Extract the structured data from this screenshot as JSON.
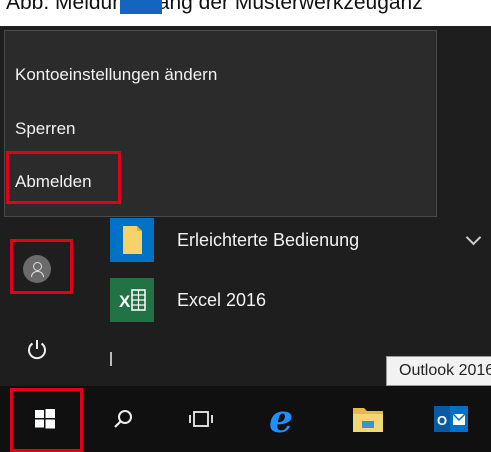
{
  "header_caption": "Abb. Meldungsgang der Musterwerkzeuganz",
  "account_menu": {
    "items": [
      {
        "label": "Kontoeinstellungen ändern"
      },
      {
        "label": "Sperren"
      },
      {
        "label": "Abmelden"
      }
    ]
  },
  "apps": [
    {
      "label": "Erleichterte Bedienung",
      "icon": "folder-icon"
    },
    {
      "label": "Excel 2016",
      "icon": "excel-icon"
    }
  ],
  "tooltip": {
    "text": "Outlook 2016"
  },
  "taskbar": {
    "buttons": [
      "start-button",
      "search-button",
      "task-view-button",
      "edge-button",
      "file-explorer-button",
      "outlook-button"
    ]
  },
  "colors": {
    "highlight": "#e0001b",
    "accent": "#0072c6",
    "excel": "#217346",
    "folder": "#f5d36b"
  }
}
